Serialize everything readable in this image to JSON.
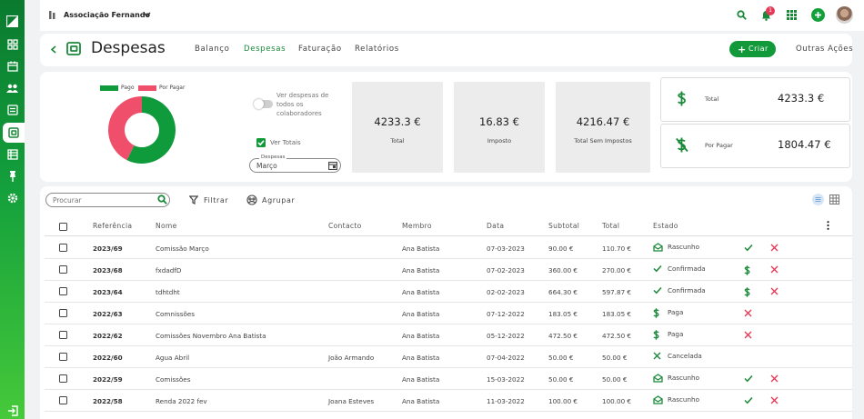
{
  "sidebar": {
    "items": [
      "logo-icon",
      "dashboard-icon",
      "calendar-icon",
      "people-icon",
      "list-icon",
      "expenses-icon",
      "book-icon",
      "pin-icon",
      "gear-icon",
      "logout-icon"
    ]
  },
  "header": {
    "org_name": "Associação Fernando",
    "notification_count": "1"
  },
  "page": {
    "title": "Despesas",
    "create_label": "Criar",
    "more_actions_label": "Outras Ações"
  },
  "tabs": [
    {
      "label": "Balanço"
    },
    {
      "label": "Despesas",
      "active": true
    },
    {
      "label": "Faturação"
    },
    {
      "label": "Relatórios"
    }
  ],
  "summary": {
    "legend": [
      {
        "label": "Pago",
        "color": "#0f9a3b"
      },
      {
        "label": "Por Pagar",
        "color": "#ef4f6b"
      }
    ],
    "toggle_label": [
      "Ver despesas de",
      "todos os",
      "colaboradores"
    ],
    "ver_totais_label": "Ver Totais",
    "date_field_label": "Despesas",
    "date_field_value": "Março",
    "stats": [
      {
        "value": "4233.3 €",
        "label": "Total"
      },
      {
        "value": "16.83 €",
        "label": "Imposto"
      },
      {
        "value": "4216.47 €",
        "label": "Total Sem Impostos"
      }
    ],
    "totals": [
      {
        "label": "Total",
        "value": "4233.3 €"
      },
      {
        "label": "Por Pagar",
        "value": "1804.47 €"
      }
    ]
  },
  "chart_data": {
    "type": "pie",
    "labels": [
      "Pago",
      "Por Pagar"
    ],
    "values": [
      2428.83,
      1804.47
    ],
    "colors": [
      "#0f9a3b",
      "#ef4f6b"
    ]
  },
  "toolbar": {
    "search_placeholder": "Procurar",
    "filter_label": "Filtrar",
    "group_label": "Agrupar"
  },
  "table": {
    "columns": [
      "Referência",
      "Nome",
      "Contacto",
      "Membro",
      "Data",
      "Subtotal",
      "Total",
      "Estado"
    ],
    "rows": [
      {
        "ref": "2023/69",
        "nome": "Comissão Março",
        "contacto": "",
        "membro": "Ana Batista",
        "data": "07-03-2023",
        "subtotal": "90.00 €",
        "total": "110.70 €",
        "estado": "Rascunho",
        "state_icon": "envelope-icon",
        "actions": [
          "check-icon",
          "close-icon"
        ]
      },
      {
        "ref": "2023/68",
        "nome": "fxdadfD",
        "contacto": "",
        "membro": "Ana Batista",
        "data": "07-02-2023",
        "subtotal": "360.00 €",
        "total": "270.00 €",
        "estado": "Confirmada",
        "state_icon": "check-icon",
        "actions": [
          "dollar-icon",
          "close-icon"
        ]
      },
      {
        "ref": "2023/64",
        "nome": "tdhtdht",
        "contacto": "",
        "membro": "Ana Batista",
        "data": "02-02-2023",
        "subtotal": "664.30 €",
        "total": "597.87 €",
        "estado": "Confirmada",
        "state_icon": "check-icon",
        "actions": [
          "dollar-icon",
          "close-icon"
        ]
      },
      {
        "ref": "2022/63",
        "nome": "Comnissões",
        "contacto": "",
        "membro": "Ana Batista",
        "data": "07-12-2022",
        "subtotal": "183.05 €",
        "total": "183.05 €",
        "estado": "Paga",
        "state_icon": "dollar-icon",
        "actions": [
          "close-icon"
        ]
      },
      {
        "ref": "2022/62",
        "nome": "Comissões Novembro Ana Batista",
        "contacto": "",
        "membro": "Ana Batista",
        "data": "05-12-2022",
        "subtotal": "472.50 €",
        "total": "472.50 €",
        "estado": "Paga",
        "state_icon": "dollar-icon",
        "actions": [
          "close-icon"
        ]
      },
      {
        "ref": "2022/60",
        "nome": "Agua Abril",
        "contacto": "João Armando",
        "membro": "Ana Batista",
        "data": "07-04-2022",
        "subtotal": "50.00 €",
        "total": "50.00 €",
        "estado": "Cancelada",
        "state_icon": "close-icon",
        "actions": []
      },
      {
        "ref": "2022/59",
        "nome": "Comissões",
        "contacto": "",
        "membro": "Ana Batista",
        "data": "15-03-2022",
        "subtotal": "50.00 €",
        "total": "50.00 €",
        "estado": "Rascunho",
        "state_icon": "envelope-icon",
        "actions": [
          "check-icon",
          "close-icon"
        ]
      },
      {
        "ref": "2022/58",
        "nome": "Renda 2022 fev",
        "contacto": "Joana Esteves",
        "membro": "Ana Batista",
        "data": "11-03-2022",
        "subtotal": "100.00 €",
        "total": "100.00 €",
        "estado": "Rascunho",
        "state_icon": "envelope-icon",
        "actions": [
          "check-icon",
          "close-icon"
        ]
      }
    ]
  }
}
